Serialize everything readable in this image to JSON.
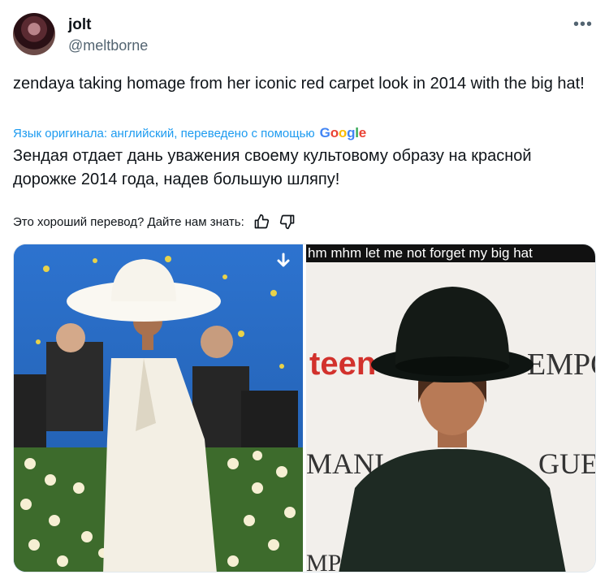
{
  "author": {
    "name": "jolt",
    "handle": "@meltborne"
  },
  "menu_icon": "more-horizontal-icon",
  "tweet": {
    "text": "zendaya taking homage from her iconic red carpet look in 2014 with the big hat!"
  },
  "translation": {
    "source_label": "Язык оригинала: английский, переведено с помощью",
    "provider_letters": [
      "G",
      "o",
      "o",
      "g",
      "l",
      "e"
    ],
    "text": "Зендая отдает дань уважения своему культовому образу на красной дорожке 2014 года, надев большую шляпу!"
  },
  "feedback": {
    "prompt": "Это хороший перевод? Дайте нам знать:",
    "like_icon": "thumbs-up-icon",
    "dislike_icon": "thumbs-down-icon"
  },
  "media": {
    "right_caption": "hm mhm let me not forget my big hat",
    "left_sign_text": "",
    "right_backdrop": [
      "teen",
      "EMPOI",
      "MANI",
      "GUE",
      "MPO"
    ]
  },
  "colors": {
    "accent": "#1d9bf0",
    "text_primary": "#0f1419",
    "text_secondary": "#536471"
  }
}
